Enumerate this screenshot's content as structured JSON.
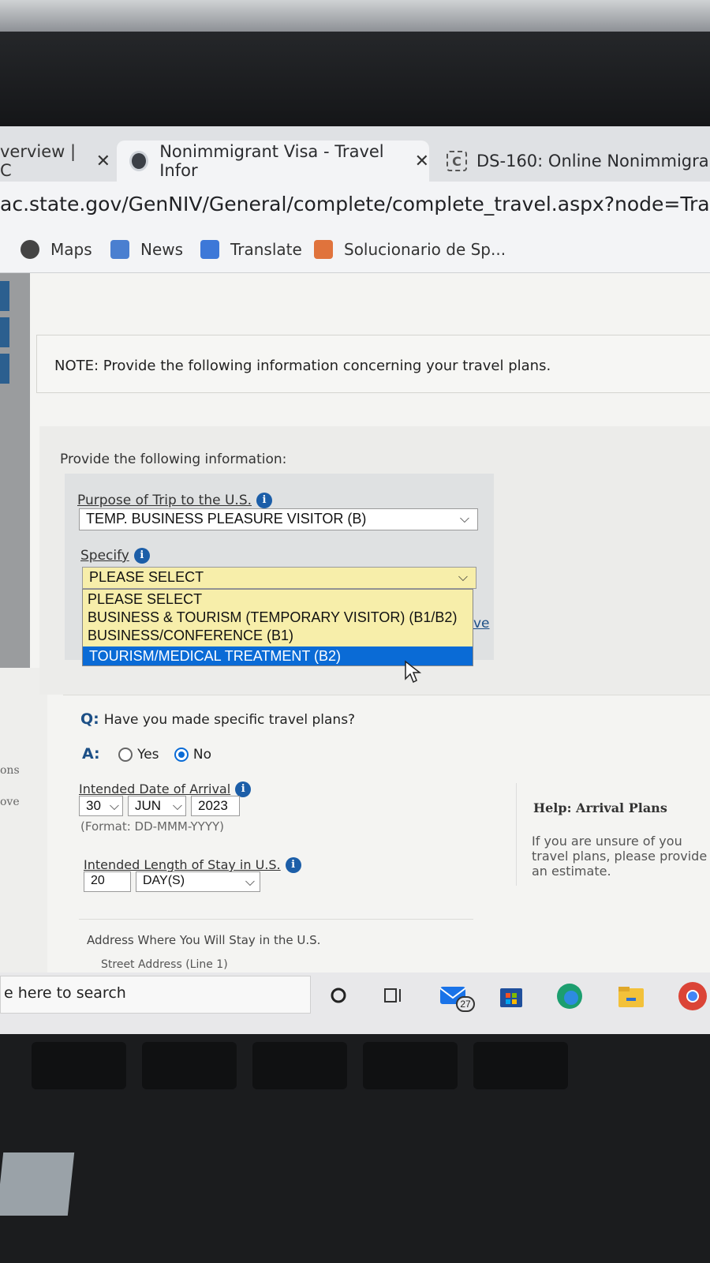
{
  "browser": {
    "tabs": [
      {
        "label": "verview | C",
        "close": "✕"
      },
      {
        "label": "Nonimmigrant Visa - Travel Infor",
        "close": "✕"
      },
      {
        "label": "DS-160: Online Nonimmigra",
        "close": ""
      }
    ],
    "url": "ac.state.gov/GenNIV/General/complete/complete_travel.aspx?node=Travel",
    "bookmarks": [
      {
        "label": "Maps",
        "icon": "maps-icon"
      },
      {
        "label": "News",
        "icon": "news-icon"
      },
      {
        "label": "Translate",
        "icon": "translate-icon"
      },
      {
        "label": "Solucionario de Sp...",
        "icon": "bookmark-icon"
      }
    ]
  },
  "sidebar": {
    "items": [
      "ons",
      "ove"
    ]
  },
  "form": {
    "note": "NOTE: Provide the following information concerning your travel plans.",
    "section_intro": "Provide the following information:",
    "purpose_label": "Purpose of Trip to the U.S.",
    "purpose_value": "TEMP. BUSINESS PLEASURE VISITOR (B)",
    "specify_label": "Specify",
    "specify_value": "PLEASE SELECT",
    "specify_options": [
      "PLEASE SELECT",
      "BUSINESS & TOURISM (TEMPORARY VISITOR) (B1/B2)",
      "BUSINESS/CONFERENCE (B1)",
      "TOURISM/MEDICAL TREATMENT (B2)"
    ],
    "specify_highlighted": "TOURISM/MEDICAL TREATMENT (B2)",
    "hidden_link_fragment": "ve",
    "question_prefix": "Q:",
    "question": "Have you made specific travel plans?",
    "answer_prefix": "A:",
    "yes_label": "Yes",
    "no_label": "No",
    "selected_answer": "No",
    "arrival_label": "Intended Date of Arrival",
    "arrival_day": "30",
    "arrival_month": "JUN",
    "arrival_year": "2023",
    "arrival_format": "(Format: DD-MMM-YYYY)",
    "stay_label": "Intended Length of Stay in U.S.",
    "stay_value": "20",
    "stay_unit": "DAY(S)",
    "address_label": "Address Where You Will Stay in the U.S.",
    "street_label": "Street Address (Line 1)"
  },
  "help": {
    "title": "Help: Arrival Plans",
    "text": "If you are unsure of you travel plans, please provide an estimate."
  },
  "taskbar": {
    "search_placeholder": "e here to search",
    "mail_badge": "27"
  },
  "colors": {
    "accent": "#0a6bd6",
    "dropdown_bg": "#f7eeaa",
    "info_icon": "#1c5ea8"
  }
}
